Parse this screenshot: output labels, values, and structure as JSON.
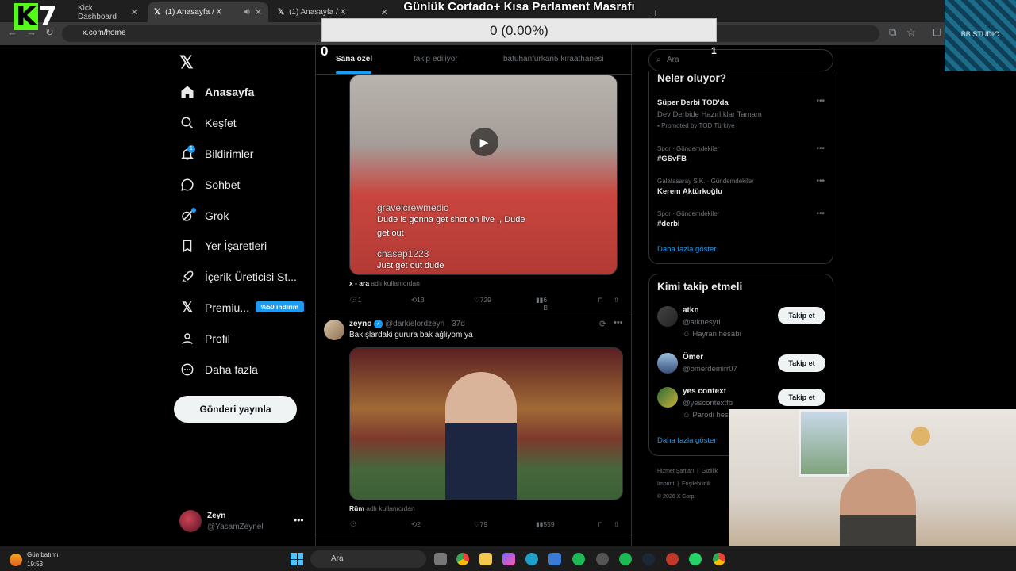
{
  "browser": {
    "tabs": [
      {
        "label": "Kick Dashboard"
      },
      {
        "label": "(1) Anasayfa / X"
      },
      {
        "label": "(1) Anasayfa / X"
      }
    ],
    "url": "x.com/home"
  },
  "overlays": {
    "stream_title": "Günlük Cortado+ Kısa Parlament Masrafı",
    "counter_box": "0 (0.00%)",
    "logo_text": "7",
    "studio_label": "BB STUDIO",
    "counter_left": "0",
    "counter_right": "1"
  },
  "sidebar": {
    "items": [
      {
        "label": "Anasayfa",
        "icon": "home-icon"
      },
      {
        "label": "Keşfet",
        "icon": "search-icon"
      },
      {
        "label": "Bildirimler",
        "icon": "bell-icon"
      },
      {
        "label": "Sohbet",
        "icon": "chat-icon"
      },
      {
        "label": "Grok",
        "icon": "grok-icon"
      },
      {
        "label": "Yer İşaretleri",
        "icon": "bookmark-icon"
      },
      {
        "label": "İçerik Üreticisi St...",
        "icon": "rocket-icon"
      },
      {
        "label": "Premiu...",
        "icon": "x-logo-icon"
      },
      {
        "label": "Profil",
        "icon": "person-icon"
      },
      {
        "label": "Daha fazla",
        "icon": "more-circle-icon"
      }
    ],
    "notification_count": "1",
    "premium_badge": "%50 indirim",
    "post_button": "Gönderi yayınla",
    "account": {
      "name": "Zeyn",
      "handle": "@YasamZeynel"
    }
  },
  "feed": {
    "tabs": [
      "Sana özel",
      "takip ediliyor",
      "batuhanfurkan5 kıraathanesi"
    ],
    "post1": {
      "video_overlay": [
        "gravelcrewmedic",
        "Dude is gonna get shot on live ,, Dude",
        "get out",
        "chasep1223",
        "Just get out dude"
      ],
      "source_user": "x - ara",
      "source_suffix": "adlı kullanıcıdan",
      "replies": "1",
      "reposts": "13",
      "likes": "729",
      "views": "6 B"
    },
    "post2": {
      "name": "zeyno",
      "handle": "@darkielordzeyn · 37d",
      "text": "Bakışlardaki gurura bak ağliyom ya",
      "source_user": "Rüm",
      "source_suffix": "adlı kullanıcıdan",
      "replies": "",
      "reposts": "2",
      "likes": "79",
      "views": "559"
    }
  },
  "right": {
    "search_placeholder": "Ara",
    "trends_title": "Neler oluyor?",
    "trends": [
      {
        "meta": "",
        "name": "Süper Derbi TOD'da",
        "sub": "Dev Derbide Hazırlıklar Tamam",
        "promo": "Promoted by TOD Türkiye"
      },
      {
        "meta": "Spor · Gündemdekiler",
        "name": "#GSvFB"
      },
      {
        "meta": "Galatasaray S.K. · Gündemdekiler",
        "name": "Kerem Aktürkoğlu"
      },
      {
        "meta": "Spor · Gündemdekiler",
        "name": "#derbi"
      }
    ],
    "trends_more": "Daha fazla göster",
    "follow_title": "Kimi takip etmeli",
    "follow": [
      {
        "name": "atkn",
        "handle": "@atknesyrl",
        "note": "Hayran hesabı",
        "button": "Takip et"
      },
      {
        "name": "Ömer",
        "handle": "@omerdemirr07",
        "note": "",
        "button": "Takip et"
      },
      {
        "name": "yes context",
        "handle": "@yescontextfb",
        "note": "Parodi hes",
        "button": "Takip et"
      }
    ],
    "follow_more": "Daha fazla göster",
    "footer": [
      "Hizmet Şartları",
      "Gizlilik",
      "Imprint",
      "Erişilebilirlik",
      "© 2026 X Corp."
    ]
  },
  "taskbar": {
    "weather_label": "Gün batımı",
    "time": "19:53",
    "search_placeholder": "Ara"
  },
  "colors": {
    "accent": "#1d9bf0",
    "kick_green": "#53fc18",
    "background": "#000000"
  }
}
